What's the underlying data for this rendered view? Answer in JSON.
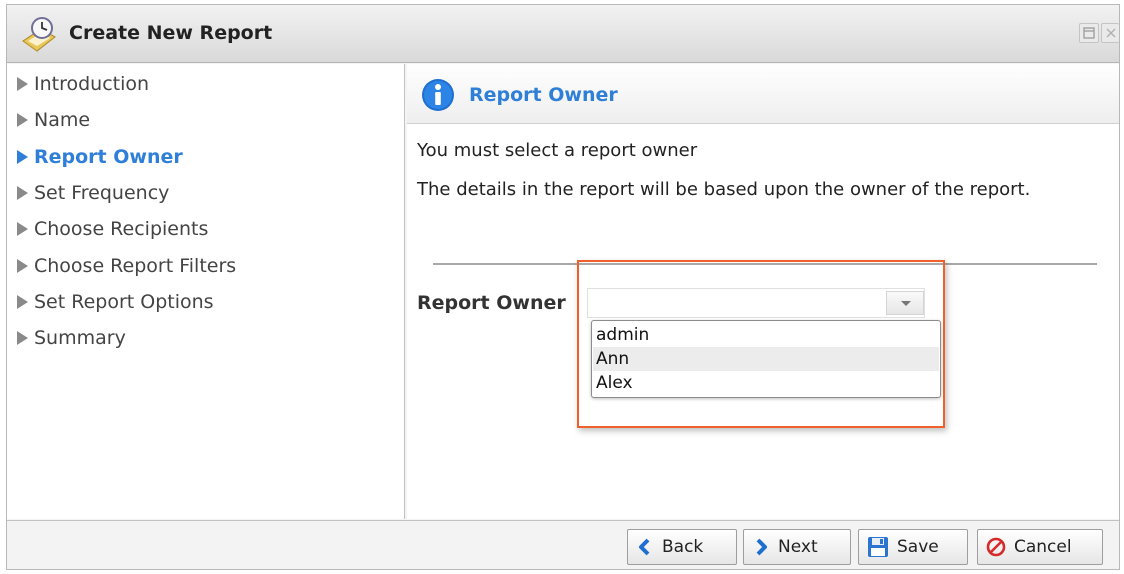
{
  "window": {
    "title": "Create New Report"
  },
  "sidebar": {
    "items": [
      {
        "label": "Introduction",
        "active": false
      },
      {
        "label": "Name",
        "active": false
      },
      {
        "label": "Report Owner",
        "active": true
      },
      {
        "label": "Set Frequency",
        "active": false
      },
      {
        "label": "Choose Recipients",
        "active": false
      },
      {
        "label": "Choose Report Filters",
        "active": false
      },
      {
        "label": "Set Report Options",
        "active": false
      },
      {
        "label": "Summary",
        "active": false
      }
    ]
  },
  "panel": {
    "title": "Report Owner",
    "message1": "You must select a report owner",
    "message2": "The details in the report will be based upon the owner of the report.",
    "field_label": "Report Owner",
    "select_value": "",
    "options": [
      "admin",
      "Ann",
      "Alex"
    ],
    "hovered_option": "Ann"
  },
  "footer": {
    "back": "Back",
    "next": "Next",
    "save": "Save",
    "cancel": "Cancel"
  },
  "colors": {
    "accent": "#2f7fd9",
    "highlight": "#f0602a",
    "cancel": "#d62b2b"
  },
  "icons": {
    "title": "report-clock-icon",
    "header": "info-icon",
    "nav": "triangle-right-icon",
    "back": "chevron-left-icon",
    "next": "chevron-right-icon",
    "save": "floppy-disk-icon",
    "cancel": "no-entry-icon"
  }
}
